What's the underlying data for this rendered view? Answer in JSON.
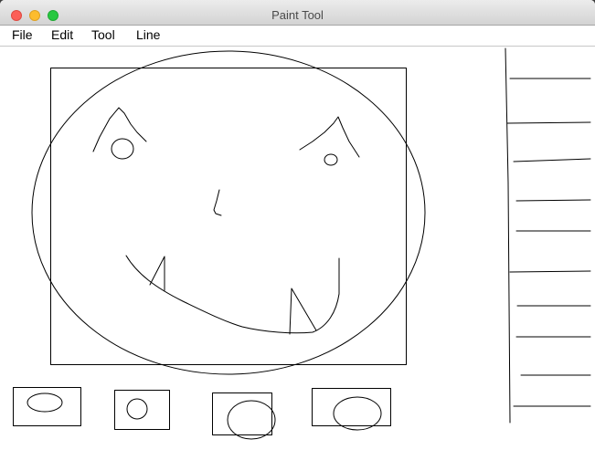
{
  "window": {
    "title": "Paint Tool"
  },
  "menu": {
    "file": "File",
    "edit": "Edit",
    "tool": "Tool",
    "line": "Line"
  },
  "colors": {
    "stroke": "#000000",
    "canvas": "#ffffff"
  },
  "canvas": {
    "shape_count": 27
  }
}
